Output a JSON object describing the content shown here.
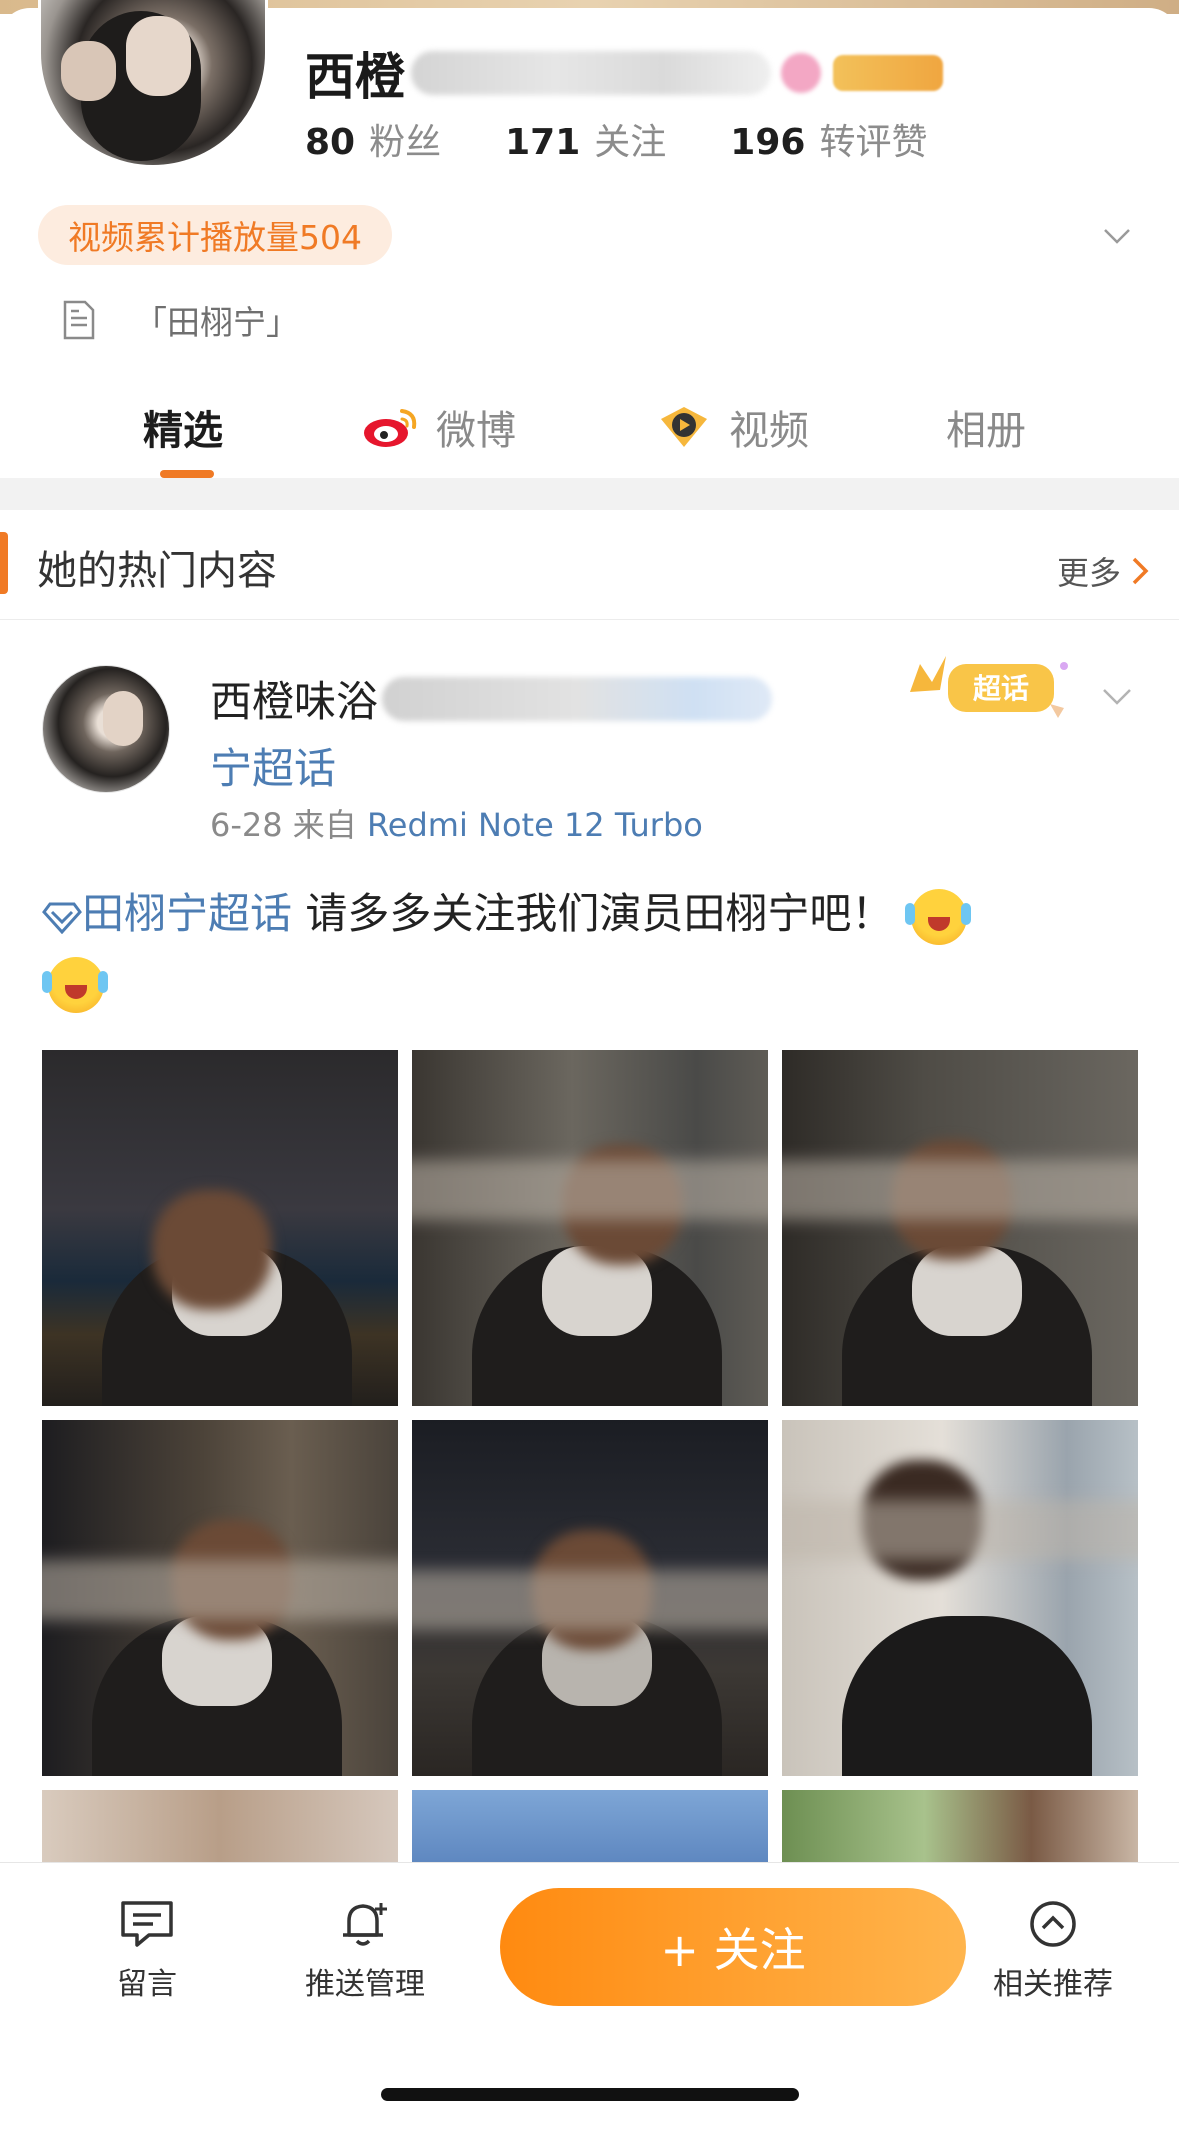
{
  "profile": {
    "name_visible": "西橙",
    "stats": [
      {
        "num": "80",
        "label": "粉丝"
      },
      {
        "num": "171",
        "label": "关注"
      },
      {
        "num": "196",
        "label": "转评赞"
      }
    ],
    "play_count_label": "视频累计播放量504",
    "bio": "「田栩宁」"
  },
  "tabs": [
    {
      "label": "精选",
      "icon": "none",
      "active": true
    },
    {
      "label": "微博",
      "icon": "weibo-icon",
      "active": false
    },
    {
      "label": "视频",
      "icon": "video-icon",
      "active": false
    },
    {
      "label": "相册",
      "icon": "none",
      "active": false
    }
  ],
  "section": {
    "title": "她的热门内容",
    "more_label": "更多"
  },
  "post": {
    "author_visible": "西橙味浴",
    "chaohua_link": "宁超话",
    "date": "6-28",
    "from_label": "来自",
    "device": "Redmi Note 12 Turbo",
    "badge_label": "超话",
    "topic": "田栩宁超话",
    "text": " 请多多关注我们演员田栩宁吧！",
    "emoji": "crying-laugh-emoji"
  },
  "bottom_bar": {
    "message_label": "留言",
    "push_label": "推送管理",
    "follow_label": "+ 关注",
    "related_label": "相关推荐"
  },
  "colors": {
    "accent": "#f07a25",
    "link": "#4d7db3"
  }
}
